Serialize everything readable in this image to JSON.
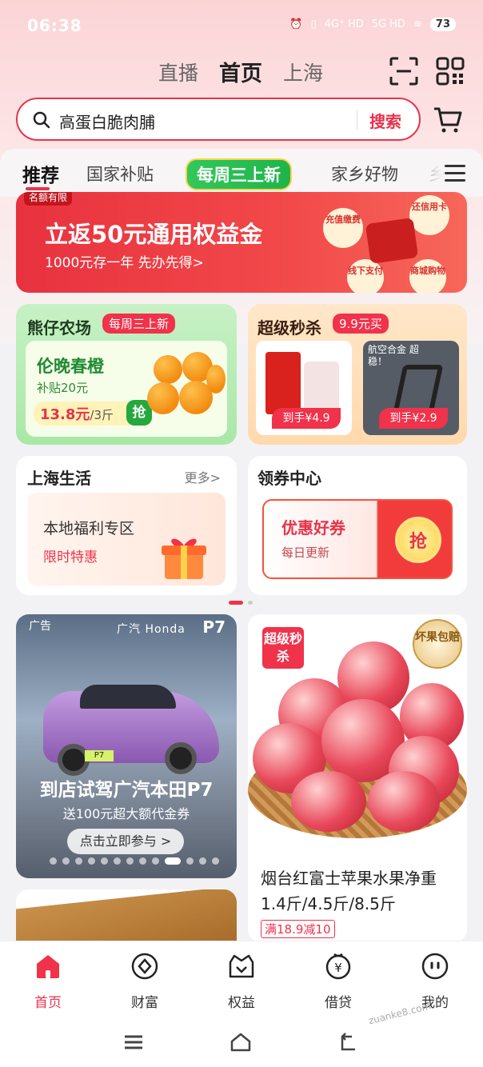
{
  "status_bar": {
    "time": "06:38",
    "signal1": "4G⁺ HD",
    "signal2": "5G HD",
    "battery": "73"
  },
  "header": {
    "tabs": [
      "直播",
      "首页",
      "上海"
    ],
    "active_tab": "首页"
  },
  "search": {
    "query": "高蛋白脆肉脯",
    "button": "搜索"
  },
  "categories": {
    "items": [
      "推荐",
      "国家补贴",
      "每周三上新",
      "家乡好物",
      "乡"
    ],
    "active": "推荐"
  },
  "banner": {
    "tag": "名额有限",
    "title": "立返50元通用权益金",
    "subtitle": "1000元存一年 先办先得>",
    "coins": [
      "充值缴费",
      "还信用卡",
      "线下支付",
      "商城购物"
    ]
  },
  "farm": {
    "title": "熊仔农场",
    "pill": "每周三上新",
    "product": "伦晚春橙",
    "subsidy": "补贴20元",
    "price": "13.8元",
    "unit": "/3斤",
    "grab": "抢"
  },
  "flash_sale": {
    "title": "超级秒杀",
    "pill": "9.9元买",
    "items": [
      {
        "price": "到手¥4.9"
      },
      {
        "label": "航空合金 超稳！",
        "price": "到手¥2.9"
      }
    ]
  },
  "shanghai_life": {
    "title": "上海生活",
    "more": "更多>",
    "line1": "本地福利专区",
    "line2": "限时特惠"
  },
  "coupon_center": {
    "title": "领券中心",
    "coupon_title": "优惠好券",
    "coupon_sub": "每日更新",
    "grab": "抢"
  },
  "car_ad": {
    "corner": "广告",
    "brand": "广汽 Honda",
    "model": "P7",
    "plate": "P7",
    "title": "到店试驾广汽本田P7",
    "subtitle": "送100元超大额代金券",
    "cta": "点击立即参与 >"
  },
  "apple_item": {
    "badge": "超级秒杀",
    "seal": "坏果包赔",
    "name": "烟台红富士苹果水果净重1.4斤/4.5斤/8.5斤",
    "promo": "满18.9减10"
  },
  "bottom_nav": [
    {
      "label": "首页",
      "icon": "home-icon",
      "active": true
    },
    {
      "label": "财富",
      "icon": "wealth-icon",
      "active": false
    },
    {
      "label": "权益",
      "icon": "benefits-icon",
      "active": false
    },
    {
      "label": "借贷",
      "icon": "loan-icon",
      "active": false
    },
    {
      "label": "我的",
      "icon": "profile-icon",
      "active": false
    }
  ],
  "watermark": "zuanke8.com",
  "colors": {
    "accent": "#f0324b",
    "green": "#25a83e"
  }
}
